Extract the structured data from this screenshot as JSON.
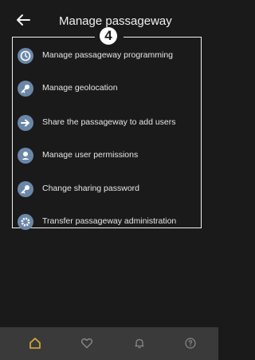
{
  "header": {
    "title": "Manage passageway",
    "back_icon": "arrow-left-icon"
  },
  "callout": {
    "number": "4"
  },
  "menu": {
    "items": [
      {
        "label": "Manage passageway programming",
        "icon": "clock-icon"
      },
      {
        "label": "Manage geolocation",
        "icon": "key-icon"
      },
      {
        "label": "Share the passageway to add users",
        "icon": "arrow-right-icon"
      },
      {
        "label": "Manage user permissions",
        "icon": "user-icon"
      },
      {
        "label": "Change sharing password",
        "icon": "key-icon"
      },
      {
        "label": "Transfer passageway administration",
        "icon": "gear-icon"
      }
    ]
  },
  "bottom_nav": {
    "items": [
      {
        "icon": "home-icon",
        "active": true
      },
      {
        "icon": "heart-icon",
        "active": false
      },
      {
        "icon": "bell-icon",
        "active": false
      },
      {
        "icon": "help-icon",
        "active": false
      }
    ]
  },
  "colors": {
    "background": "#1a1a1a",
    "icon_circle": "#6a87a8",
    "nav_bar": "#3a3a3a",
    "active_accent": "#d9b23a",
    "inactive_icon": "#8a8a8a"
  }
}
